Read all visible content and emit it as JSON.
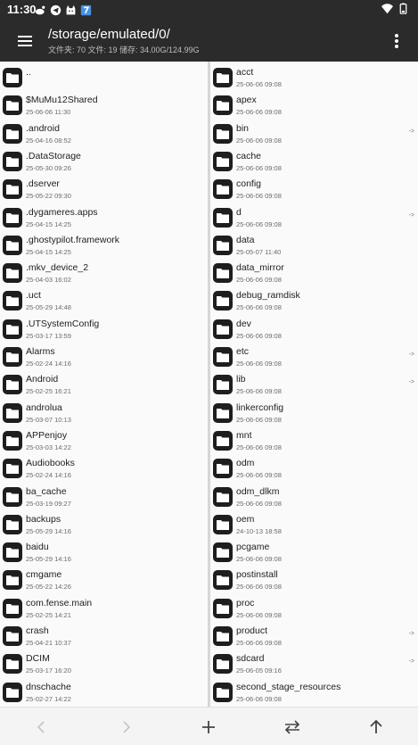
{
  "status_bar": {
    "time": "11:30",
    "left_icons": [
      "weibo-icon",
      "telegram-icon",
      "cat-icon",
      "app-icon"
    ],
    "right_icons": [
      "wifi-icon",
      "battery-icon"
    ]
  },
  "app_bar": {
    "path": "/storage/emulated/0/",
    "stats": "文件夹: 70  文件: 19  储存: 34.00G/124.99G"
  },
  "left_pane": [
    {
      "name": "..",
      "date": ""
    },
    {
      "name": "$MuMu12Shared",
      "date": "25-06-06 11:30"
    },
    {
      "name": ".android",
      "date": "25-04-16 08:52"
    },
    {
      "name": ".DataStorage",
      "date": "25-05-30 09:26"
    },
    {
      "name": ".dserver",
      "date": "25-05-22 09:30"
    },
    {
      "name": ".dygameres.apps",
      "date": "25-04-15 14:25"
    },
    {
      "name": ".ghostypilot.framework",
      "date": "25-04-15 14:25"
    },
    {
      "name": ".mkv_device_2",
      "date": "25-04-03 16:02"
    },
    {
      "name": ".uct",
      "date": "25-05-29 14:48"
    },
    {
      "name": ".UTSystemConfig",
      "date": "25-03-17 13:59"
    },
    {
      "name": "Alarms",
      "date": "25-02-24 14:16"
    },
    {
      "name": "Android",
      "date": "25-02-25 16:21"
    },
    {
      "name": "androlua",
      "date": "25-03-07 10:13"
    },
    {
      "name": "APPenjoy",
      "date": "25-03-03 14:22"
    },
    {
      "name": "Audiobooks",
      "date": "25-02-24 14:16"
    },
    {
      "name": "ba_cache",
      "date": "25-03-19 09:27"
    },
    {
      "name": "backups",
      "date": "25-05-29 14:16"
    },
    {
      "name": "baidu",
      "date": "25-05-29 14:16"
    },
    {
      "name": "cmgame",
      "date": "25-05-22 14:26"
    },
    {
      "name": "com.fense.main",
      "date": "25-02-25 14:21"
    },
    {
      "name": "crash",
      "date": "25-04-21 10:37"
    },
    {
      "name": "DCIM",
      "date": "25-03-17 16:20"
    },
    {
      "name": "dnschache",
      "date": "25-02-27 14:22"
    }
  ],
  "right_pane": [
    {
      "name": "acct",
      "date": "25-06-06 09:08",
      "arrow": ""
    },
    {
      "name": "apex",
      "date": "25-06-06 09:08",
      "arrow": ""
    },
    {
      "name": "bin",
      "date": "25-06-06 09:08",
      "arrow": "->"
    },
    {
      "name": "cache",
      "date": "25-06-06 09:08",
      "arrow": ""
    },
    {
      "name": "config",
      "date": "25-06-06 09:08",
      "arrow": ""
    },
    {
      "name": "d",
      "date": "25-06-06 09:08",
      "arrow": "->"
    },
    {
      "name": "data",
      "date": "25-05-07 11:40",
      "arrow": ""
    },
    {
      "name": "data_mirror",
      "date": "25-06-06 09:08",
      "arrow": ""
    },
    {
      "name": "debug_ramdisk",
      "date": "25-06-06 09:08",
      "arrow": ""
    },
    {
      "name": "dev",
      "date": "25-06-06 09:08",
      "arrow": ""
    },
    {
      "name": "etc",
      "date": "25-06-06 09:08",
      "arrow": "->"
    },
    {
      "name": "lib",
      "date": "25-06-06 09:08",
      "arrow": "->"
    },
    {
      "name": "linkerconfig",
      "date": "25-06-06 09:08",
      "arrow": ""
    },
    {
      "name": "mnt",
      "date": "25-06-06 09:08",
      "arrow": ""
    },
    {
      "name": "odm",
      "date": "25-06-06 09:08",
      "arrow": ""
    },
    {
      "name": "odm_dlkm",
      "date": "25-06-06 09:08",
      "arrow": ""
    },
    {
      "name": "oem",
      "date": "24-10-13 18:58",
      "arrow": ""
    },
    {
      "name": "pcgame",
      "date": "25-06-06 09:08",
      "arrow": ""
    },
    {
      "name": "postinstall",
      "date": "25-06-06 09:08",
      "arrow": ""
    },
    {
      "name": "proc",
      "date": "25-06-06 09:08",
      "arrow": ""
    },
    {
      "name": "product",
      "date": "25-06-06 09:08",
      "arrow": "->"
    },
    {
      "name": "sdcard",
      "date": "25-06-05 09:16",
      "arrow": "->"
    },
    {
      "name": "second_stage_resources",
      "date": "25-06-06 09:08",
      "arrow": ""
    }
  ],
  "bottom_bar": {
    "buttons": [
      "back-icon",
      "forward-icon",
      "add-icon",
      "swap-icon",
      "up-icon"
    ]
  }
}
